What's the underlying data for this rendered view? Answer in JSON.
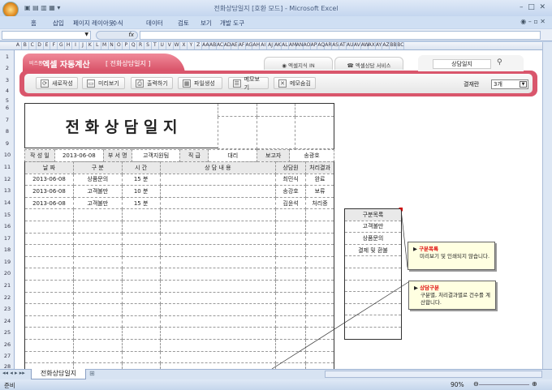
{
  "window": {
    "title": "전화상담일지  [호환 모드] - Microsoft Excel"
  },
  "ribbon_tabs": [
    "홈",
    "삽입",
    "페이지 레이아웃",
    "수식",
    "데이터",
    "검토",
    "보기",
    "개발 도구"
  ],
  "formula_bar": {
    "fx_label": "fx",
    "value": ""
  },
  "columns": [
    "A",
    "B",
    "C",
    "D",
    "E",
    "F",
    "G",
    "H",
    "I",
    "J",
    "K",
    "L",
    "M",
    "N",
    "O",
    "P",
    "Q",
    "R",
    "S",
    "T",
    "U",
    "V",
    "W",
    "X",
    "Y",
    "Z",
    "AA",
    "AB",
    "AC",
    "AD",
    "AE",
    "AF",
    "AG",
    "AH",
    "AI",
    "AJ",
    "AK",
    "AL",
    "AM",
    "AN",
    "AO",
    "AP",
    "AQ",
    "AR",
    "AS",
    "AT",
    "AU",
    "AV",
    "AW",
    "AX",
    "AY",
    "AZ",
    "BB",
    "BC"
  ],
  "rows": [
    "1",
    "2",
    "3",
    "4",
    "5",
    "6",
    "7",
    "8",
    "9",
    "10",
    "11",
    "12",
    "13",
    "14",
    "15",
    "16",
    "17",
    "18",
    "19",
    "20",
    "21",
    "22",
    "23",
    "24",
    "25",
    "26",
    "27",
    "28"
  ],
  "banner": {
    "brand_small": "비즈폼",
    "brand": "엑셀 자동계산",
    "doc": "[ 전화상담일지 ]",
    "link1": "엑셀지식 IN",
    "link2": "엑셀상담 서비스",
    "search": "상담일지",
    "buttons": [
      "새로작성",
      "미리보기",
      "출력하기",
      "파일생성",
      "메모보기",
      "메모숨김"
    ],
    "approval_label": "결재란",
    "approval_value": "3개"
  },
  "form": {
    "title": "전 화 상 담 일 지",
    "info": {
      "date_label": "작 성 일",
      "date": "2013-06-08",
      "dept_label": "부 서 명",
      "dept": "고객지원팀",
      "rank_label": "직  급",
      "rank": "대리",
      "reporter_label": "보고자",
      "reporter": "송광호"
    },
    "headers": [
      "날    짜",
      "구    분",
      "시    간",
      "상    담    내    용",
      "상담원",
      "처리결과"
    ],
    "records": [
      {
        "date": "2013-06-08",
        "type": "상품문의",
        "time": "15 분",
        "content": "",
        "agent": "최민식",
        "result": "완료"
      },
      {
        "date": "2013-06-08",
        "type": "고객불만",
        "time": "10 분",
        "content": "",
        "agent": "송강호",
        "result": "보류"
      },
      {
        "date": "2013-06-08",
        "type": "고객불만",
        "time": "15 분",
        "content": "",
        "agent": "김윤석",
        "result": "처리중"
      }
    ]
  },
  "category_list": {
    "header": "구분목록",
    "items": [
      "고객불만",
      "상품문의",
      "결제 및 환불"
    ]
  },
  "comments": [
    {
      "title": "구분목록",
      "text": "미리보기 및 인쇄되지 않습니다."
    },
    {
      "title": "상담구분",
      "text": "구분별, 처리결과별로 건수를 계산합니다."
    }
  ],
  "sheet_tab": "전화상담일지",
  "status": {
    "mode": "준비",
    "zoom": "90%"
  }
}
